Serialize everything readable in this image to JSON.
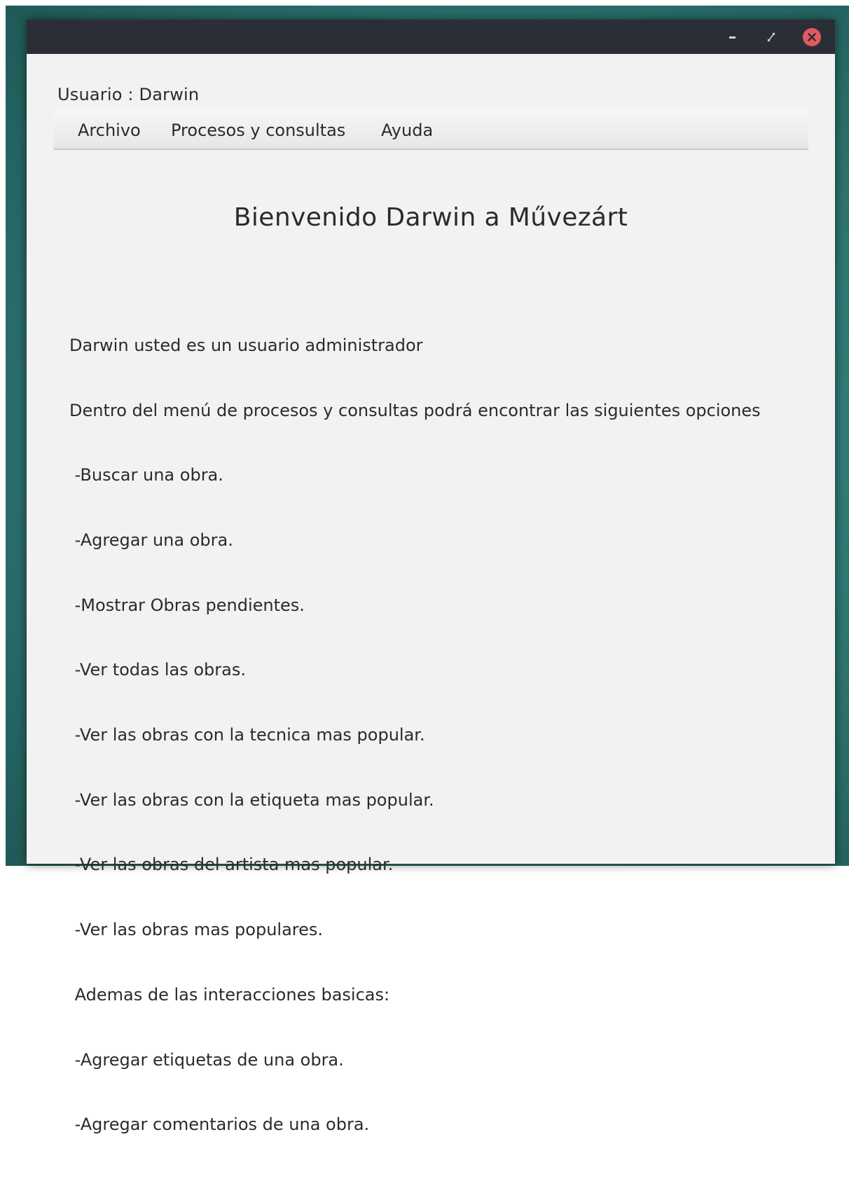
{
  "window": {
    "controls": {
      "minimize_icon": "minimize-icon",
      "maximize_icon": "maximize-icon",
      "close_icon": "close-icon",
      "close_color": "#e05c5c",
      "titlebar_color": "#2b2e37"
    }
  },
  "user_label": "Usuario : Darwin",
  "menu": {
    "items": [
      {
        "label": "Archivo"
      },
      {
        "label": "Procesos y consultas"
      },
      {
        "label": "Ayuda"
      }
    ]
  },
  "welcome_title": "Bienvenido Darwin a Művezárt",
  "info_lines": [
    "Darwin usted es un usuario administrador",
    "Dentro del menú de procesos y consultas podrá encontrar las siguientes opciones",
    " -Buscar una obra.",
    " -Agregar una obra.",
    " -Mostrar Obras pendientes.",
    " -Ver todas las obras.",
    " -Ver las obras con la tecnica mas popular.",
    " -Ver las obras con la etiqueta mas popular.",
    " -Ver las obras del artista mas popular.",
    " -Ver las obras mas populares.",
    " Ademas de las interacciones basicas:",
    " -Agregar etiquetas de una obra.",
    " -Agregar comentarios de una obra."
  ]
}
